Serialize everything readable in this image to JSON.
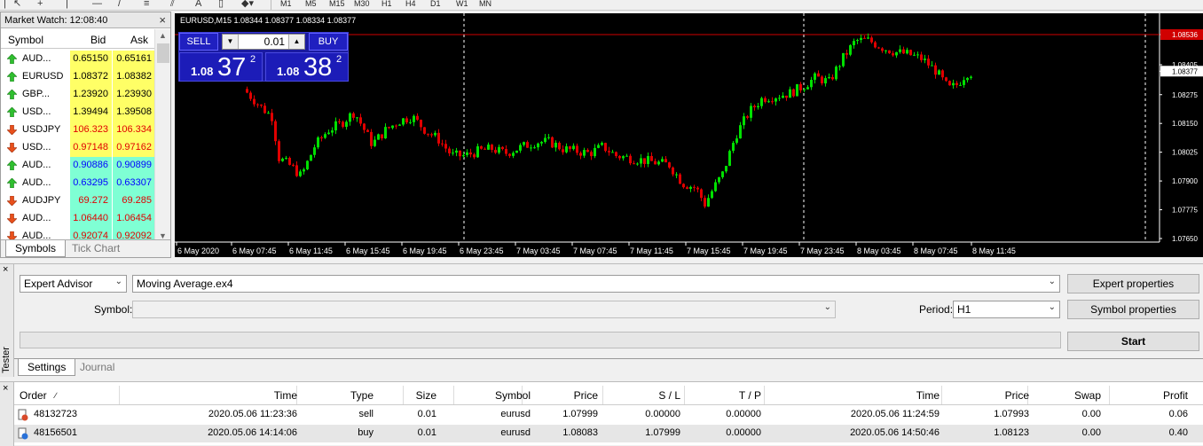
{
  "toolbar": {
    "timeframes": [
      "M1",
      "M5",
      "M15",
      "M30",
      "H1",
      "H4",
      "D1",
      "W1",
      "MN"
    ],
    "text_tool": "A"
  },
  "market_watch": {
    "title": "Market Watch: 12:08:40",
    "headers": {
      "symbol": "Symbol",
      "bid": "Bid",
      "ask": "Ask"
    },
    "rows": [
      {
        "symbol": "AUD...",
        "bid": "0.65150",
        "ask": "0.65161",
        "dir": "up",
        "bg": "#ffff66",
        "text": "#000000"
      },
      {
        "symbol": "EURUSD",
        "bid": "1.08372",
        "ask": "1.08382",
        "dir": "up",
        "bg": "#ffff66",
        "text": "#000000"
      },
      {
        "symbol": "GBP...",
        "bid": "1.23920",
        "ask": "1.23930",
        "dir": "up",
        "bg": "#ffff66",
        "text": "#000000"
      },
      {
        "symbol": "USD...",
        "bid": "1.39494",
        "ask": "1.39508",
        "dir": "up",
        "bg": "#ffff66",
        "text": "#000000"
      },
      {
        "symbol": "USDJPY",
        "bid": "106.323",
        "ask": "106.334",
        "dir": "down",
        "bg": "#ffff66",
        "text": "#e00000"
      },
      {
        "symbol": "USD...",
        "bid": "0.97148",
        "ask": "0.97162",
        "dir": "down",
        "bg": "#ffff66",
        "text": "#e00000"
      },
      {
        "symbol": "AUD...",
        "bid": "0.90886",
        "ask": "0.90899",
        "dir": "up",
        "bg": "#7fffd4",
        "text": "#0000ff"
      },
      {
        "symbol": "AUD...",
        "bid": "0.63295",
        "ask": "0.63307",
        "dir": "up",
        "bg": "#7fffd4",
        "text": "#0000ff"
      },
      {
        "symbol": "AUDJPY",
        "bid": "69.272",
        "ask": "69.285",
        "dir": "down",
        "bg": "#7fffd4",
        "text": "#e00000"
      },
      {
        "symbol": "AUD...",
        "bid": "1.06440",
        "ask": "1.06454",
        "dir": "down",
        "bg": "#7fffd4",
        "text": "#e00000"
      },
      {
        "symbol": "AUD...",
        "bid": "0.92074",
        "ask": "0.92092",
        "dir": "down",
        "bg": "#7fffd4",
        "text": "#e00000"
      }
    ],
    "tabs": [
      "Symbols",
      "Tick Chart"
    ]
  },
  "chart": {
    "title": "EURUSD,M15  1.08344 1.08377 1.08334 1.08377",
    "sell_label": "SELL",
    "buy_label": "BUY",
    "volume": "0.01",
    "sell_price": {
      "prefix": "1.08",
      "big": "37",
      "sup": "2"
    },
    "buy_price": {
      "prefix": "1.08",
      "big": "38",
      "sup": "2"
    },
    "price_axis": [
      "1.08536",
      "1.08405",
      "1.08377",
      "1.08275",
      "1.08150",
      "1.08025",
      "1.07900",
      "1.07775",
      "1.07650"
    ],
    "time_axis": [
      "6 May 2020",
      "6 May 07:45",
      "6 May 11:45",
      "6 May 15:45",
      "6 May 19:45",
      "6 May 23:45",
      "7 May 03:45",
      "7 May 07:45",
      "7 May 11:45",
      "7 May 15:45",
      "7 May 19:45",
      "7 May 23:45",
      "8 May 03:45",
      "8 May 07:45",
      "8 May 11:45"
    ],
    "up_color": "#00e000",
    "down_color": "#e00000"
  },
  "tester": {
    "side_label": "Tester",
    "type_value": "Expert Advisor",
    "ea_value": "Moving Average.ex4",
    "symbol_label": "Symbol:",
    "symbol_value": "",
    "period_label": "Period:",
    "period_value": "H1",
    "expert_properties": "Expert properties",
    "symbol_properties": "Symbol properties",
    "start": "Start",
    "tabs": [
      "Settings",
      "Journal"
    ]
  },
  "orders": {
    "headers": [
      "Order",
      "Time",
      "Type",
      "Size",
      "Symbol",
      "Price",
      "S / L",
      "T / P",
      "Time",
      "Price",
      "Swap",
      "Profit"
    ],
    "rows": [
      [
        "48132723",
        "2020.05.06 11:23:36",
        "sell",
        "0.01",
        "eurusd",
        "1.07999",
        "0.00000",
        "0.00000",
        "2020.05.06 11:24:59",
        "1.07993",
        "0.00",
        "0.06"
      ],
      [
        "48156501",
        "2020.05.06 14:14:06",
        "buy",
        "0.01",
        "eurusd",
        "1.08083",
        "1.07999",
        "0.00000",
        "2020.05.06 14:50:46",
        "1.08123",
        "0.00",
        "0.40"
      ]
    ]
  }
}
